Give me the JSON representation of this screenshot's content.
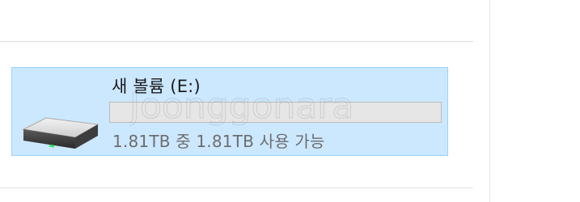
{
  "drive": {
    "name": "새 볼륨 (E:)",
    "space_text": "1.81TB 중 1.81TB 사용 가능",
    "used_fraction": 0.0,
    "icon": "hard-drive-icon",
    "selected": true
  },
  "colors": {
    "tile_background": "#cce8ff",
    "tile_border": "#99d1ff",
    "bar_background": "#e6e6e6",
    "bar_fill": "#26a0da",
    "secondary_text": "#6d6d6d"
  },
  "watermark": {
    "text": "Joonggonara"
  }
}
